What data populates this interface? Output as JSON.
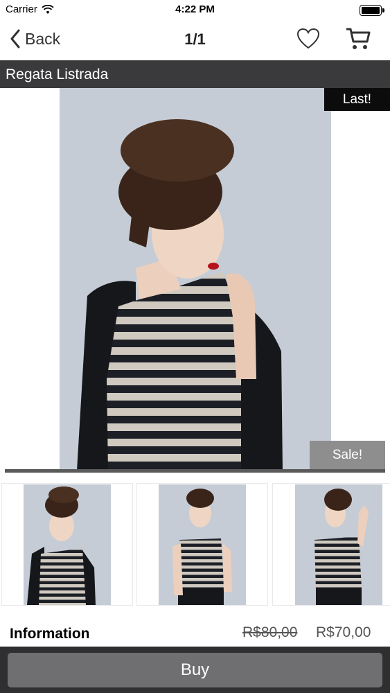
{
  "status_bar": {
    "carrier": "Carrier",
    "time": "4:22 PM"
  },
  "nav": {
    "back_label": "Back",
    "title": "1/1",
    "favorite_icon": "heart-icon",
    "cart_icon": "cart-icon"
  },
  "product": {
    "name": "Regata Listrada",
    "badge_last": "Last!",
    "badge_sale": "Sale!",
    "images_count": 3
  },
  "info": {
    "label": "Information",
    "price_old": "R$80,00",
    "price_new": "R$70,00"
  },
  "buy": {
    "label": "Buy"
  },
  "colors": {
    "title_strip": "#3a3a3c",
    "buy_bar": "#2f2f31",
    "buy_button": "#6f6f71",
    "sale_badge": "#8e8e8e",
    "last_badge": "#0c0c0c"
  }
}
